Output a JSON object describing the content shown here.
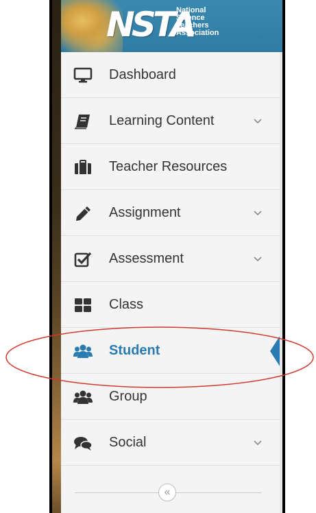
{
  "brand": {
    "logo_text": "NSTA",
    "org_name_lines": [
      "National",
      "Science",
      "Teachers",
      "Association"
    ],
    "header_color": "#2f7ba3"
  },
  "menu": {
    "items": [
      {
        "label": "Dashboard",
        "icon": "monitor-icon",
        "has_submenu": false
      },
      {
        "label": "Learning Content",
        "icon": "book-icon",
        "has_submenu": true
      },
      {
        "label": "Teacher Resources",
        "icon": "briefcase-icon",
        "has_submenu": false
      },
      {
        "label": "Assignment",
        "icon": "pencil-icon",
        "has_submenu": true
      },
      {
        "label": "Assessment",
        "icon": "checkbox-icon",
        "has_submenu": true
      },
      {
        "label": "Class",
        "icon": "grid-icon",
        "has_submenu": false
      },
      {
        "label": "Student",
        "icon": "users-icon",
        "has_submenu": false,
        "active": true
      },
      {
        "label": "Group",
        "icon": "users-icon",
        "has_submenu": false
      },
      {
        "label": "Social",
        "icon": "comments-icon",
        "has_submenu": true
      }
    ],
    "collapse_glyph": "«",
    "active_color": "#2a7bb0",
    "annotation_color": "#d0392b"
  }
}
